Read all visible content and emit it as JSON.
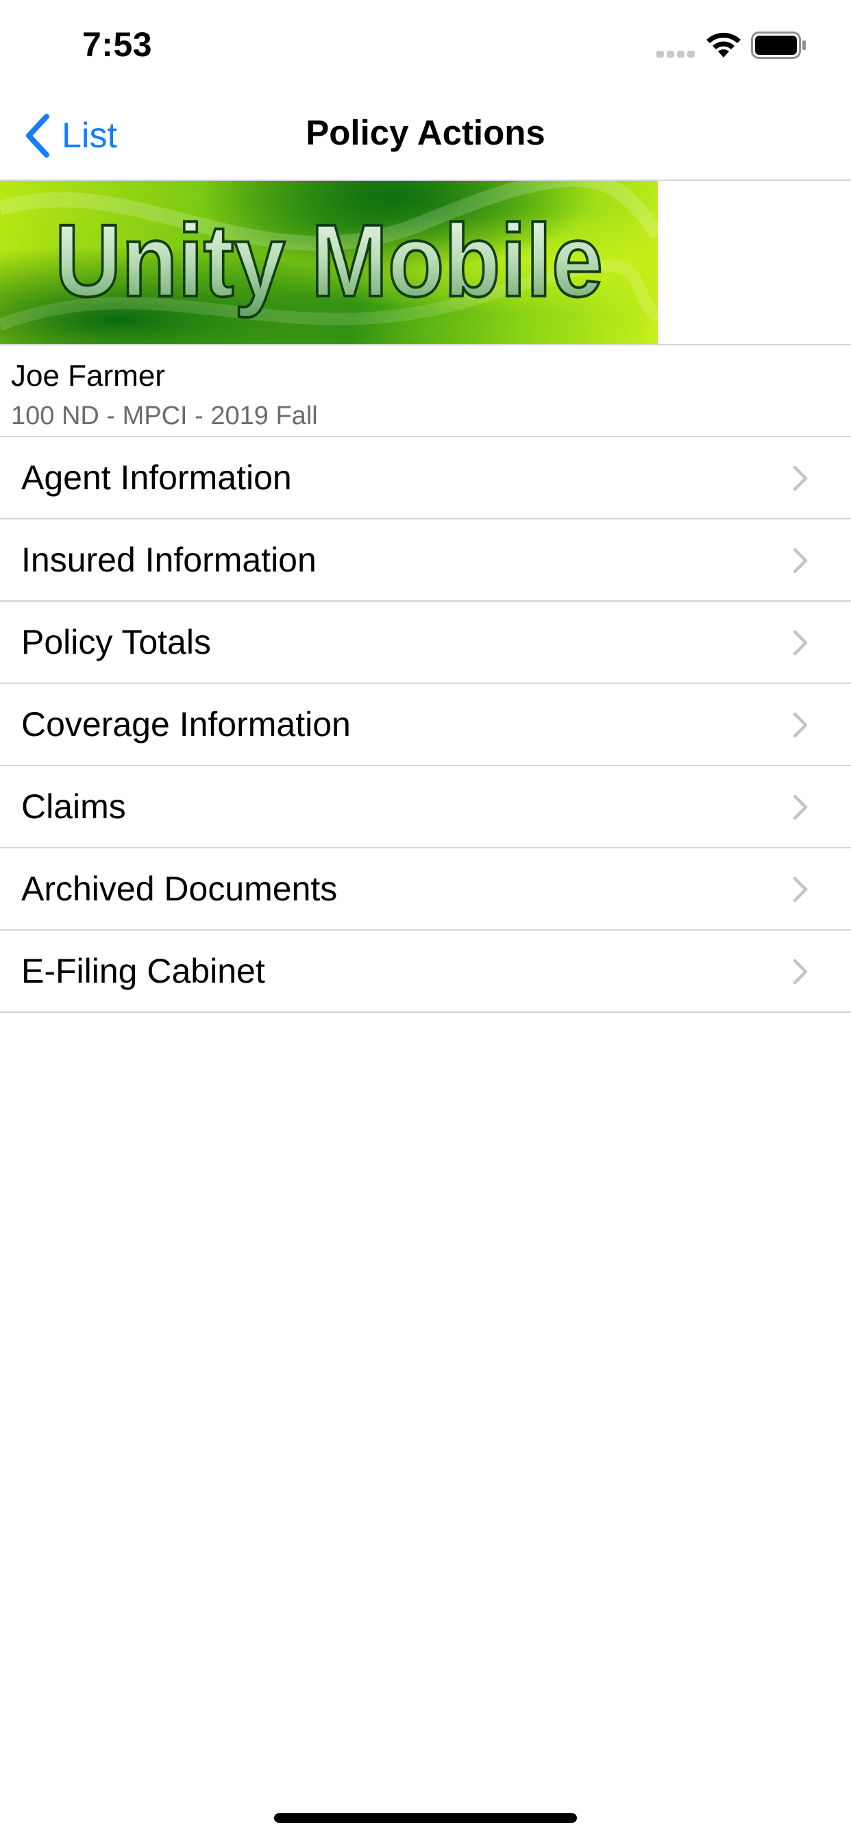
{
  "status_bar": {
    "time": "7:53",
    "icons": [
      "cellular-signal-icon",
      "wifi-icon",
      "battery-icon"
    ]
  },
  "nav": {
    "back_label": "List",
    "title": "Policy Actions",
    "accent_color": "#147efb"
  },
  "banner": {
    "logo_text": "Unity Mobile"
  },
  "policy": {
    "insured_name": "Joe Farmer",
    "description": "100 ND - MPCI - 2019 Fall"
  },
  "menu": {
    "items": [
      {
        "label": "Agent Information"
      },
      {
        "label": "Insured Information"
      },
      {
        "label": "Policy Totals"
      },
      {
        "label": "Coverage Information"
      },
      {
        "label": "Claims"
      },
      {
        "label": "Archived Documents"
      },
      {
        "label": "E-Filing Cabinet"
      }
    ]
  }
}
